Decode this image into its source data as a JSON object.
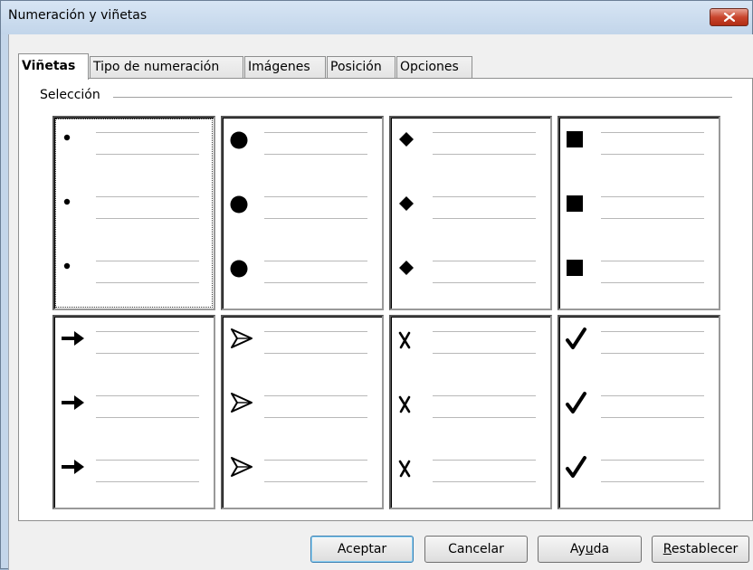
{
  "window": {
    "title": "Numeración y viñetas"
  },
  "tabs": [
    {
      "label": "Viñetas",
      "active": true
    },
    {
      "label": "Tipo de numeración",
      "active": false
    },
    {
      "label": "Imágenes",
      "active": false
    },
    {
      "label": "Posición",
      "active": false
    },
    {
      "label": "Opciones",
      "active": false
    }
  ],
  "selection": {
    "label": "Selección"
  },
  "bullet_styles": [
    {
      "name": "small-dot",
      "glyph": "•",
      "selected": true
    },
    {
      "name": "large-dot",
      "glyph": "●",
      "selected": false
    },
    {
      "name": "diamond",
      "glyph": "◆",
      "selected": false
    },
    {
      "name": "square",
      "glyph": "■",
      "selected": false
    },
    {
      "name": "arrow",
      "glyph": "➔",
      "selected": false
    },
    {
      "name": "arrowhead",
      "glyph": "➢",
      "selected": false
    },
    {
      "name": "cross",
      "glyph": "✗",
      "selected": false
    },
    {
      "name": "check",
      "glyph": "✔",
      "selected": false
    }
  ],
  "buttons": {
    "ok": "Aceptar",
    "cancel": "Cancelar",
    "help": "Ayuda",
    "reset": "Restablecer"
  },
  "colors": {
    "title_bar": "#c4d6ea",
    "close_button": "#c9452d",
    "default_button_border": "#3c7fb1"
  }
}
